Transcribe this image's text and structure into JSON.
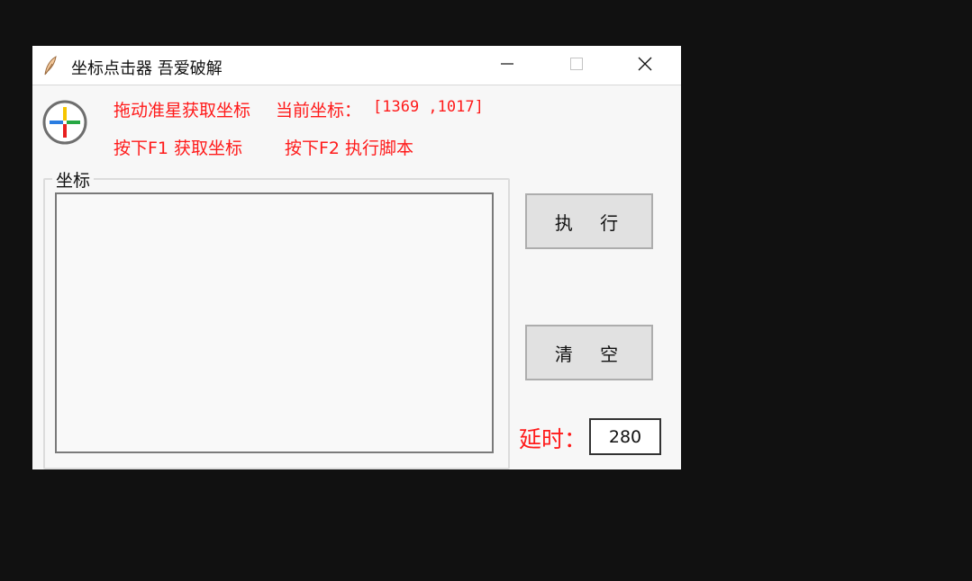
{
  "window": {
    "title": "坐标点击器  吾爱破解",
    "app_icon": "feather-pen-icon",
    "controls": {
      "minimize_icon": "minimize-icon",
      "maximize_icon": "maximize-icon",
      "close_icon": "close-icon"
    }
  },
  "info": {
    "crosshair_icon": "crosshair-icon",
    "drag_hint": "拖动准星获取坐标",
    "current_label": "当前坐标：",
    "current_value": "[1369 ,1017]",
    "f1_hint": "按下F1 获取坐标",
    "f2_hint": "按下F2  执行脚本"
  },
  "coords_group": {
    "label": "坐标",
    "content": ""
  },
  "buttons": {
    "execute": "执 行",
    "clear": "清 空"
  },
  "delay": {
    "label": "延时：",
    "value": "280"
  },
  "colors": {
    "accent_red": "#ff1a1a",
    "button_bg": "#e1e1e1",
    "window_bg": "#f7f7f7",
    "desktop_bg": "#111111"
  }
}
